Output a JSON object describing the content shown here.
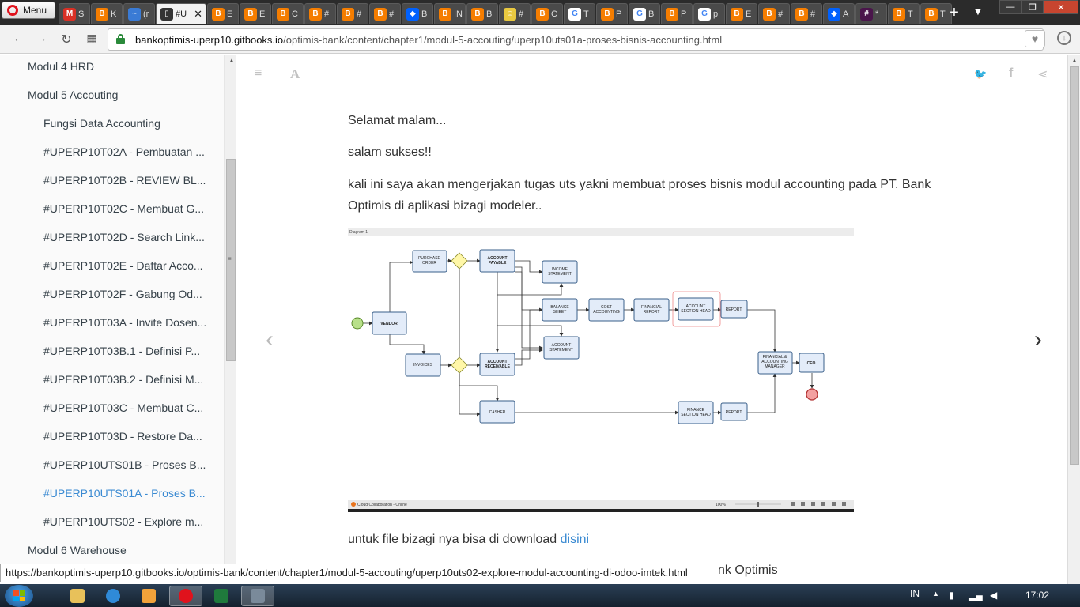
{
  "browser": {
    "menu_label": "Menu",
    "tabs": [
      {
        "title": "S",
        "icon": "gmail-icon",
        "color": "#d93025",
        "glyph": "M"
      },
      {
        "title": "K",
        "icon": "blogger-icon",
        "color": "#f57d00",
        "glyph": "B"
      },
      {
        "title": "(r",
        "icon": "tab-icon",
        "color": "#3a7bd5",
        "glyph": "~"
      },
      {
        "title": "#U",
        "icon": "gitbook-icon",
        "color": "#333333",
        "glyph": "▯",
        "active": true
      },
      {
        "title": "E",
        "icon": "blogger-icon",
        "color": "#f57d00",
        "glyph": "B"
      },
      {
        "title": "E",
        "icon": "blogger-icon",
        "color": "#f57d00",
        "glyph": "B"
      },
      {
        "title": "C",
        "icon": "blogger-icon",
        "color": "#f57d00",
        "glyph": "B"
      },
      {
        "title": "#",
        "icon": "blogger-icon",
        "color": "#f57d00",
        "glyph": "B"
      },
      {
        "title": "#",
        "icon": "blogger-icon",
        "color": "#f57d00",
        "glyph": "B"
      },
      {
        "title": "#",
        "icon": "blogger-icon",
        "color": "#f57d00",
        "glyph": "B"
      },
      {
        "title": "B",
        "icon": "dropbox-icon",
        "color": "#0061fe",
        "glyph": "◆"
      },
      {
        "title": "IN",
        "icon": "blogger-icon",
        "color": "#f57d00",
        "glyph": "B"
      },
      {
        "title": "B",
        "icon": "blogger-icon",
        "color": "#f57d00",
        "glyph": "B"
      },
      {
        "title": "#",
        "icon": "minion-icon",
        "color": "#e8c840",
        "glyph": "☺"
      },
      {
        "title": "C",
        "icon": "blogger-icon",
        "color": "#f57d00",
        "glyph": "B"
      },
      {
        "title": "T",
        "icon": "google-icon",
        "color": "#ffffff",
        "glyph": "G"
      },
      {
        "title": "P",
        "icon": "blogger-icon",
        "color": "#f57d00",
        "glyph": "B"
      },
      {
        "title": "B",
        "icon": "google-icon",
        "color": "#ffffff",
        "glyph": "G"
      },
      {
        "title": "P",
        "icon": "blogger-icon",
        "color": "#f57d00",
        "glyph": "B"
      },
      {
        "title": "p",
        "icon": "google-icon",
        "color": "#ffffff",
        "glyph": "G"
      },
      {
        "title": "E",
        "icon": "blogger-icon",
        "color": "#f57d00",
        "glyph": "B"
      },
      {
        "title": "#",
        "icon": "blogger-icon",
        "color": "#f57d00",
        "glyph": "B"
      },
      {
        "title": "#",
        "icon": "blogger-icon",
        "color": "#f57d00",
        "glyph": "B"
      },
      {
        "title": "A",
        "icon": "dropbox-icon",
        "color": "#0061fe",
        "glyph": "◆"
      },
      {
        "title": "*",
        "icon": "slack-icon",
        "color": "#4a154b",
        "glyph": "#"
      },
      {
        "title": "T",
        "icon": "blogger-icon",
        "color": "#f57d00",
        "glyph": "B"
      },
      {
        "title": "T",
        "icon": "blogger-icon",
        "color": "#f57d00",
        "glyph": "B"
      }
    ],
    "url_host": "bankoptimis-uperp10.gitbooks.io",
    "url_path": "/optimis-bank/content/chapter1/modul-5-accouting/uperp10uts01a-proses-bisnis-accounting.html",
    "status_url": "https://bankoptimis-uperp10.gitbooks.io/optimis-bank/content/chapter1/modul-5-accouting/uperp10uts02-explore-modul-accounting-di-odoo-imtek.html"
  },
  "sidebar": {
    "items": [
      {
        "label": "Modul 4 HRD",
        "level": 1
      },
      {
        "label": "Modul 5 Accouting",
        "level": 1
      },
      {
        "label": "Fungsi Data Accounting",
        "level": 2
      },
      {
        "label": "#UPERP10T02A - Pembuatan ...",
        "level": 2
      },
      {
        "label": "#UPERP10T02B - REVIEW BL...",
        "level": 2
      },
      {
        "label": "#UPERP10T02C - Membuat G...",
        "level": 2
      },
      {
        "label": "#UPERP10T02D - Search Link...",
        "level": 2
      },
      {
        "label": "#UPERP10T02E - Daftar Acco...",
        "level": 2
      },
      {
        "label": "#UPERP10T02F - Gabung Od...",
        "level": 2
      },
      {
        "label": "#UPERP10T03A - Invite Dosen...",
        "level": 2
      },
      {
        "label": "#UPERP10T03B.1 - Definisi P...",
        "level": 2
      },
      {
        "label": "#UPERP10T03B.2 - Definisi M...",
        "level": 2
      },
      {
        "label": "#UPERP10T03C - Membuat C...",
        "level": 2
      },
      {
        "label": "#UPERP10T03D - Restore Da...",
        "level": 2
      },
      {
        "label": "#UPERP10UTS01B - Proses B...",
        "level": 2
      },
      {
        "label": "#UPERP10UTS01A - Proses B...",
        "level": 2,
        "active": true
      },
      {
        "label": "#UPERP10UTS02 - Explore m...",
        "level": 2
      },
      {
        "label": "Modul 6 Warehouse",
        "level": 1
      }
    ]
  },
  "content": {
    "p1": "Selamat malam...",
    "p2": "salam sukses!!",
    "p3": "kali ini saya akan mengerjakan tugas uts yakni membuat proses bisnis modul accounting pada PT. Bank Optimis di aplikasi bizagi modeler..",
    "p4_prefix": "untuk file bizagi nya bisa di download ",
    "p4_link": "disini",
    "trailing": "nk Optimis"
  },
  "diagram": {
    "title": "Diagram 1",
    "footer_app": "Cloud Collaboration - Online",
    "zoom": "100%",
    "nodes": {
      "vendor": "VENDOR",
      "purchase_order": [
        "PURCHASE",
        "ORDER"
      ],
      "account_payable": [
        "ACCOUNT",
        "PAYABLE"
      ],
      "income_statement": [
        "INCOME",
        "STATEMENT"
      ],
      "balance_sheet": [
        "BALANCE",
        "SHEET"
      ],
      "cost_accounting": [
        "COST",
        "ACCOUNTING"
      ],
      "financial_report": [
        "FINANCIAL",
        "REPORT"
      ],
      "account_section_head": [
        "ACCOUNT",
        "SECTION HEAD"
      ],
      "report1": "REPORT",
      "account_statement": [
        "ACCOUNT",
        "STATEMENT"
      ],
      "invoices": "INVOICES",
      "account_receivable": [
        "ACCOUNT",
        "RECEIVABLE"
      ],
      "financial_accounting_manager": [
        "FINANCIAL &",
        "ACCOUNTING",
        "MANAGER"
      ],
      "ceo": "CEO",
      "casher": "CASHER",
      "finance_section_head": [
        "FINANCE",
        "SECTION HEAD"
      ],
      "report2": "REPORT"
    }
  },
  "taskbar": {
    "lang": "IN",
    "time": "17:02"
  }
}
